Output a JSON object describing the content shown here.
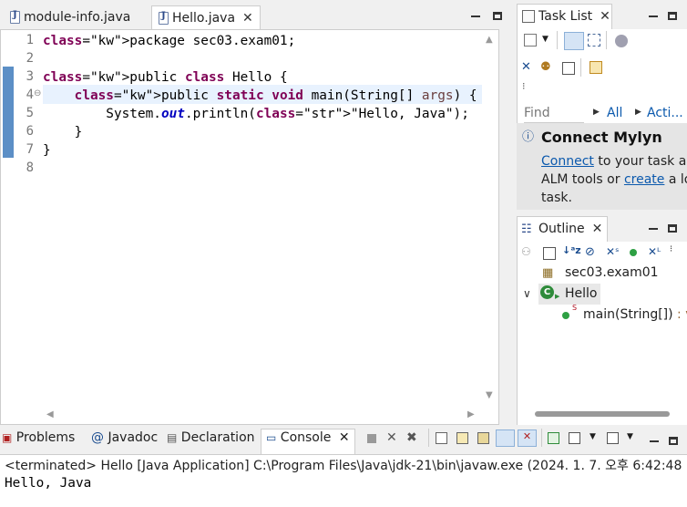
{
  "editor": {
    "tabs": [
      {
        "label": "module-info.java",
        "active": false
      },
      {
        "label": "Hello.java",
        "active": true
      }
    ],
    "lines": [
      {
        "num": "1",
        "text": "package sec03.exam01;"
      },
      {
        "num": "2",
        "text": ""
      },
      {
        "num": "3",
        "text": "public class Hello {"
      },
      {
        "num": "4",
        "text": "    public static void main(String[] args) {"
      },
      {
        "num": "5",
        "text": "        System.out.println(\"Hello, Java\");"
      },
      {
        "num": "6",
        "text": "    }"
      },
      {
        "num": "7",
        "text": "}"
      },
      {
        "num": "8",
        "text": ""
      }
    ]
  },
  "tasklist": {
    "title": "Task List",
    "find_placeholder": "Find",
    "all_label": "All",
    "activate_label": "Acti...",
    "mylyn_title": "Connect Mylyn",
    "mylyn_connect": "Connect",
    "mylyn_text1": " to your task ar",
    "mylyn_text2": "ALM tools or ",
    "mylyn_create": "create",
    "mylyn_text3": " a lo",
    "mylyn_text4": "task."
  },
  "outline": {
    "title": "Outline",
    "package": "sec03.exam01",
    "class": "Hello",
    "method": "main(String[])",
    "method_suffix": " : v"
  },
  "bottom": {
    "tabs": [
      {
        "label": "Problems"
      },
      {
        "label": "Javadoc"
      },
      {
        "label": "Declaration"
      },
      {
        "label": "Console"
      }
    ],
    "status": "<terminated> Hello [Java Application] C:\\Program Files\\Java\\jdk-21\\bin\\javaw.exe  (2024. 1. 7. 오후 6:42:48",
    "output": "Hello, Java"
  },
  "colors": {
    "keyword": "#7f0055",
    "string": "#2a00ff",
    "field": "#0000c0",
    "link": "#0b59ad",
    "gutter": "#5c8fc6"
  }
}
